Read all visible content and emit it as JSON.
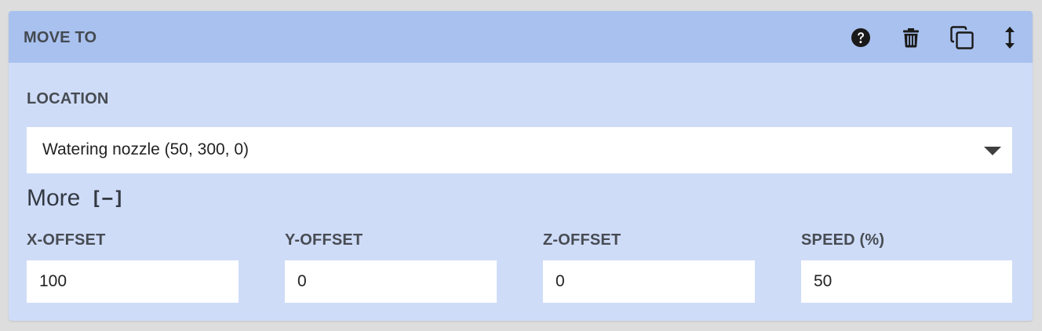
{
  "header": {
    "title": "MOVE TO",
    "icons": [
      "help-icon",
      "trash-icon",
      "duplicate-icon",
      "drag-icon"
    ]
  },
  "location": {
    "label": "LOCATION",
    "value": "Watering nozzle (50, 300, 0)"
  },
  "more": {
    "label": "More",
    "toggle": "[−]"
  },
  "fields": {
    "x_offset": {
      "label": "X-OFFSET",
      "value": "100"
    },
    "y_offset": {
      "label": "Y-OFFSET",
      "value": "0"
    },
    "z_offset": {
      "label": "Z-OFFSET",
      "value": "0"
    },
    "speed": {
      "label": "SPEED (%)",
      "value": "50"
    }
  },
  "colors": {
    "header_bg": "#a9c1ee",
    "panel_bg": "#cfdcf8",
    "text": "#444a52"
  }
}
